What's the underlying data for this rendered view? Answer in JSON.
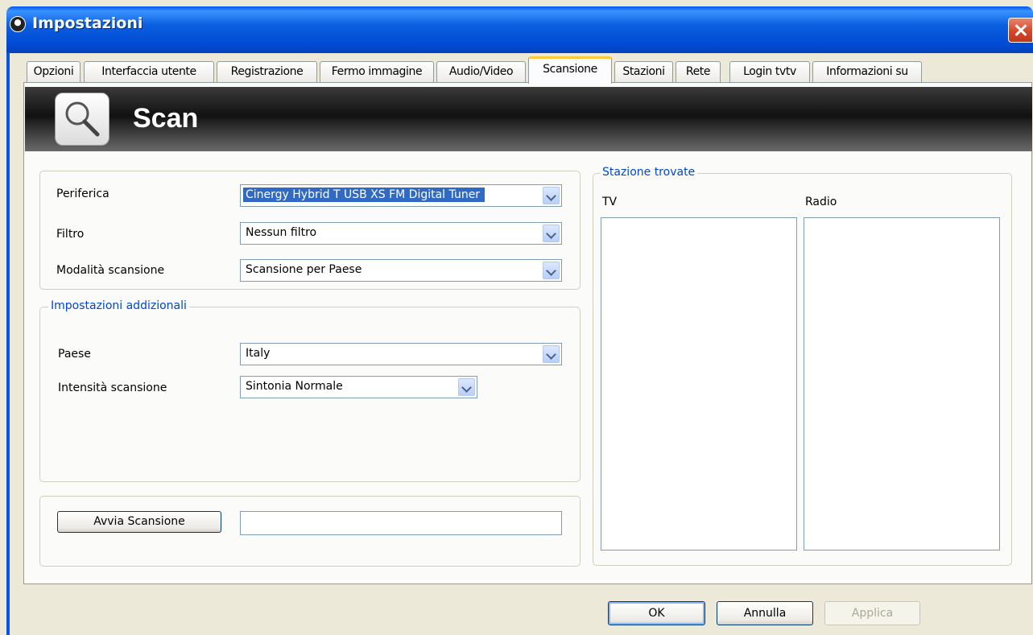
{
  "window": {
    "title": "Impostazioni"
  },
  "tabs": [
    {
      "label": "Opzioni"
    },
    {
      "label": "Interfaccia utente"
    },
    {
      "label": "Registrazione"
    },
    {
      "label": "Fermo immagine"
    },
    {
      "label": "Audio/Video"
    },
    {
      "label": "Scansione",
      "active": true
    },
    {
      "label": "Stazioni"
    },
    {
      "label": "Rete"
    },
    {
      "label": "Login tvtv"
    },
    {
      "label": "Informazioni su"
    }
  ],
  "banner": {
    "title": "Scan",
    "icon": "magnifier-icon"
  },
  "device_group": {
    "device_label": "Periferica",
    "device_value": "Cinergy Hybrid T USB XS FM Digital Tuner",
    "filter_label": "Filtro",
    "filter_value": "Nessun filtro",
    "mode_label": "Modalità scansione",
    "mode_value": "Scansione per Paese"
  },
  "additional": {
    "legend": "Impostazioni addizionali",
    "country_label": "Paese",
    "country_value": "Italy",
    "intensity_label": "Intensità scansione",
    "intensity_value": "Sintonia Normale"
  },
  "scan": {
    "start_label": "Avvia Scansione",
    "progress_text": ""
  },
  "stations": {
    "legend": "Stazione trovate",
    "tv_label": "TV",
    "radio_label": "Radio",
    "tv_items": [],
    "radio_items": []
  },
  "footer": {
    "ok_label": "OK",
    "cancel_label": "Annulla",
    "apply_label": "Applica"
  },
  "colors": {
    "accent": "#0046d5",
    "titlebar": "#0149d1",
    "selection": "#316ac5"
  }
}
